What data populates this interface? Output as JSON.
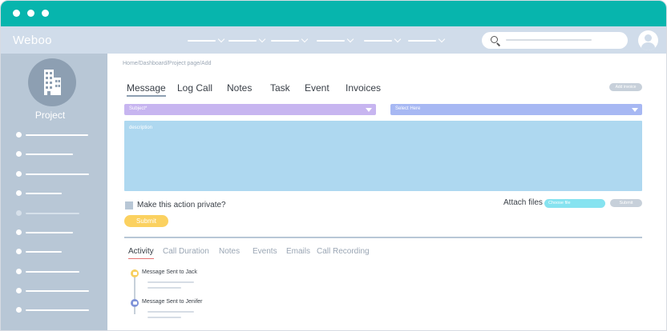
{
  "colors": {
    "titlebar": "#07b5ad",
    "appbar": "#d0dcea",
    "sidebar": "#b8c7d6",
    "subject_select": "#c7b5f0",
    "select_here": "#a7b8f3",
    "description": "#aed8f0",
    "submit": "#fbd160",
    "choose_file": "#86e3f0",
    "activity_underline": "#e57373",
    "timeline_node_1": "#f7cf5f",
    "timeline_node_2": "#7f93d8"
  },
  "app": {
    "brand": "Weboo"
  },
  "sidebar": {
    "project_label": "Project",
    "project_icon": "building-icon"
  },
  "breadcrumb": "Home/Dashboard/Project page/Add",
  "tabs": [
    {
      "label": "Message"
    },
    {
      "label": "Log Call"
    },
    {
      "label": "Notes"
    },
    {
      "label": "Task"
    },
    {
      "label": "Event"
    },
    {
      "label": "Invoices"
    }
  ],
  "add_invoice_label": "Add invoice",
  "form": {
    "subject_placeholder": "Subject*",
    "select_placeholder": "Select Here",
    "description_placeholder": "description",
    "private_label": "Make this action private?",
    "attach_label": "Attach files",
    "choose_file_label": "Choose file",
    "attach_submit_label": "Submit",
    "submit_label": "Submit"
  },
  "activity_tabs": [
    {
      "label": "Activity"
    },
    {
      "label": "Call Duration"
    },
    {
      "label": "Notes"
    },
    {
      "label": "Events"
    },
    {
      "label": "Emails"
    },
    {
      "label": "Call Recording"
    }
  ],
  "timeline": [
    {
      "text": "Message Sent to Jack"
    },
    {
      "text": "Message Sent to Jenifer"
    }
  ]
}
